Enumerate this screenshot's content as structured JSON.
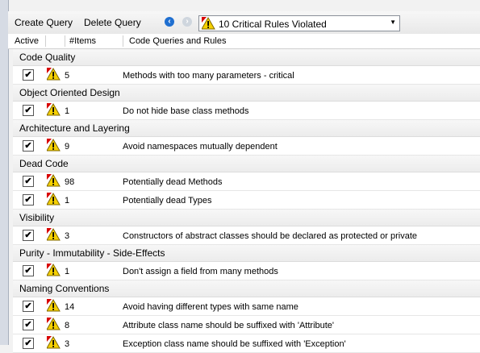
{
  "toolbar": {
    "create_label": "Create Query",
    "delete_label": "Delete Query",
    "dropdown_value": "10 Critical Rules Violated"
  },
  "columns": {
    "active": "Active",
    "items": "#Items",
    "rules": "Code Queries and Rules"
  },
  "groups": [
    {
      "name": "Code Quality",
      "rules": [
        {
          "active": true,
          "count": "5",
          "name": "Methods with too many parameters - critical"
        }
      ]
    },
    {
      "name": "Object Oriented Design",
      "rules": [
        {
          "active": true,
          "count": "1",
          "name": "Do not hide base class methods"
        }
      ]
    },
    {
      "name": "Architecture and Layering",
      "rules": [
        {
          "active": true,
          "count": "9",
          "name": "Avoid namespaces mutually dependent"
        }
      ]
    },
    {
      "name": "Dead Code",
      "rules": [
        {
          "active": true,
          "count": "98",
          "name": "Potentially dead Methods"
        },
        {
          "active": true,
          "count": "1",
          "name": "Potentially dead Types"
        }
      ]
    },
    {
      "name": "Visibility",
      "rules": [
        {
          "active": true,
          "count": "3",
          "name": "Constructors of abstract classes should be declared as protected or private"
        }
      ]
    },
    {
      "name": "Purity - Immutability - Side-Effects",
      "rules": [
        {
          "active": true,
          "count": "1",
          "name": "Don't assign a field from many methods"
        }
      ]
    },
    {
      "name": "Naming Conventions",
      "rules": [
        {
          "active": true,
          "count": "14",
          "name": "Avoid having different types with same name"
        },
        {
          "active": true,
          "count": "8",
          "name": "Attribute class name should be suffixed with 'Attribute'"
        },
        {
          "active": true,
          "count": "3",
          "name": "Exception class name should be suffixed with 'Exception'"
        }
      ]
    }
  ]
}
